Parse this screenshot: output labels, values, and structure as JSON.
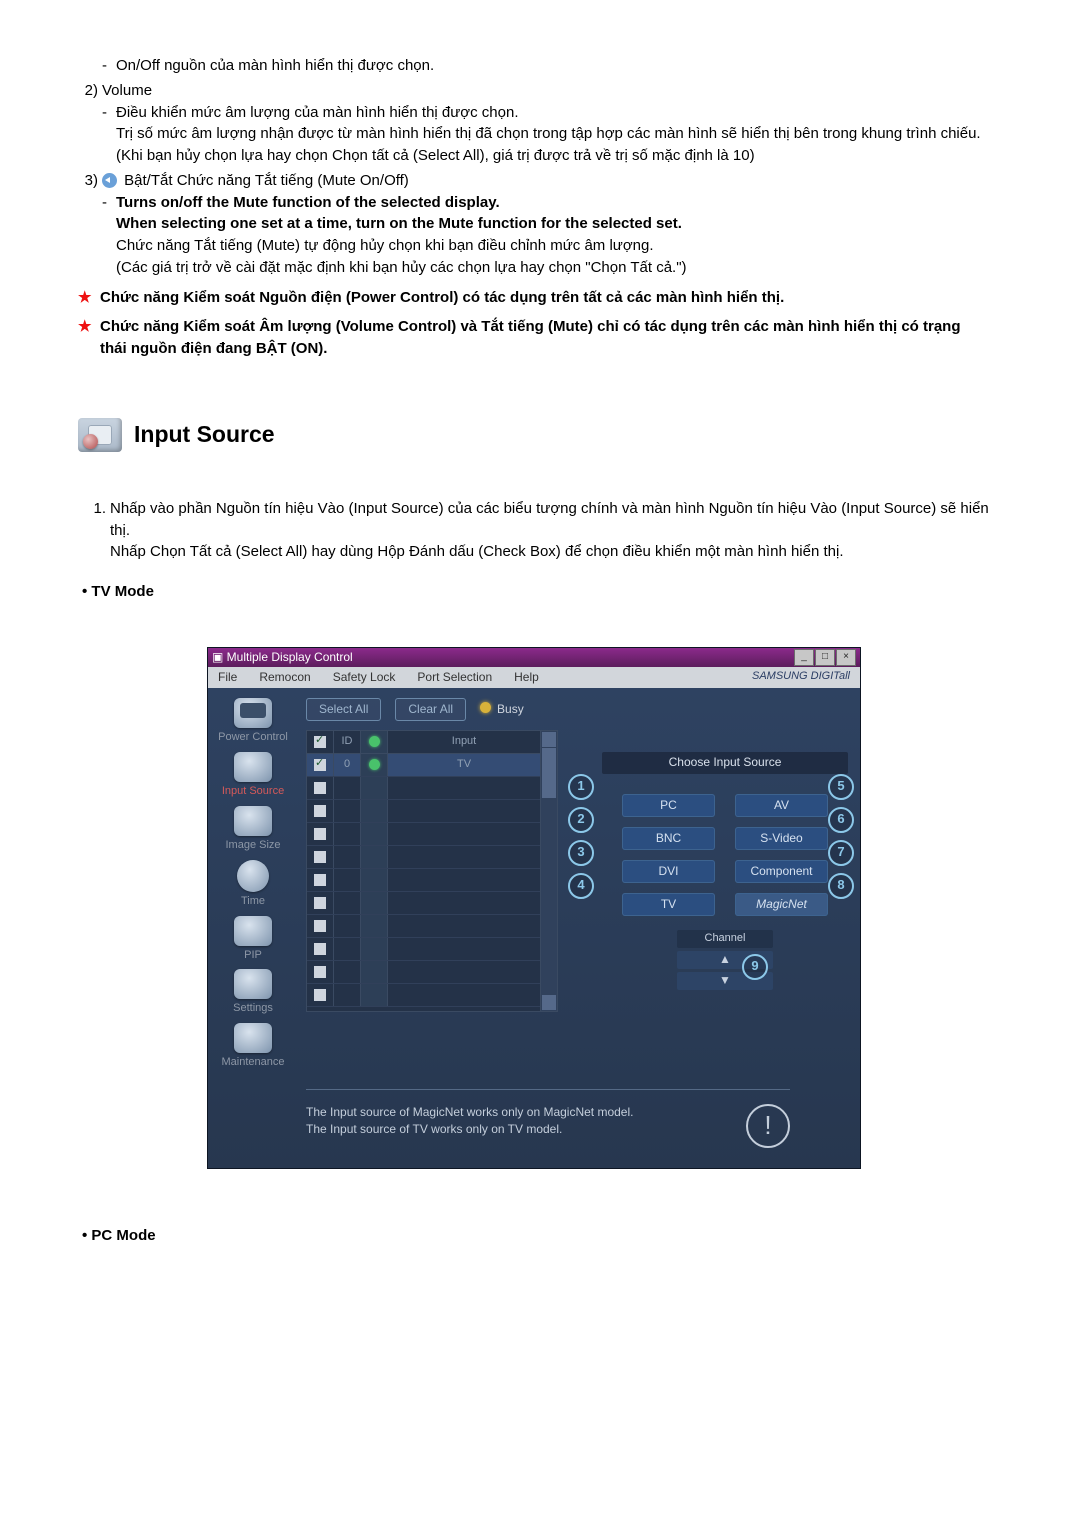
{
  "top": {
    "item_onoff": "On/Off nguồn của màn hình hiển thị được chọn.",
    "item2_num": "2)",
    "item2_title": "Volume",
    "item2_dash": "Điều khiển mức âm lượng của màn hình hiển thị được chọn.",
    "item2_sub1": "Trị số mức âm lượng nhận được từ màn hình hiển thị đã chọn trong tập hợp các màn hình sẽ hiển thị bên trong khung trình chiếu.",
    "item2_sub2": "(Khi bạn hủy chọn lựa hay chọn Chọn tất cả (Select All), giá trị được trả về trị số mặc định là 10)",
    "item3_num": "3)",
    "item3_title": "Bật/Tắt Chức năng Tắt tiếng (Mute On/Off)",
    "item3_dash1": "Turns on/off the Mute function of the selected display.",
    "item3_dash2": "When selecting one set at a time, turn on the Mute function for the selected set.",
    "item3_sub1": "Chức năng Tắt tiếng (Mute) tự động hủy chọn khi bạn điều chỉnh mức âm lượng.",
    "item3_sub2": "(Các giá trị trở về cài đặt mặc định khi bạn hủy các chọn lựa hay chọn \"Chọn Tất cả.\")",
    "star1": "Chức năng Kiểm soát Nguồn điện (Power Control) có tác dụng trên tất cả các màn hình hiển thị.",
    "star2": "Chức năng Kiểm soát Âm lượng (Volume Control) và Tắt tiếng (Mute) chỉ có tác dụng trên các màn hình hiển thị có trạng thái nguồn điện đang BẬT (ON)."
  },
  "section": {
    "title": "Input Source",
    "li1_num": "1.",
    "li1_a": "Nhấp vào phần Nguồn tín hiệu Vào (Input Source) của các biểu tượng chính và màn hình Nguồn tín hiệu Vào (Input Source) sẽ hiển thị.",
    "li1_b": "Nhấp Chọn Tất cả (Select All) hay dùng Hộp Đánh dấu (Check Box) để chọn điều khiển một màn hình hiển thị.",
    "tv_mode": "• TV Mode",
    "pc_mode": "• PC Mode"
  },
  "shot": {
    "title": "Multiple Display Control",
    "menu": {
      "file": "File",
      "rescan": "Remocon",
      "safety": "Safety Lock",
      "port": "Port Selection",
      "help": "Help",
      "brand": "SAMSUNG DIGITall"
    },
    "selectall": "Select All",
    "clearall": "Clear All",
    "busy": "Busy",
    "grid": {
      "chk": "✓",
      "id": "ID",
      "st": "",
      "input": "Input",
      "row_id": "0",
      "row_input": "TV"
    },
    "sidebar": {
      "pc": "Power Control",
      "is": "Input Source",
      "img": "Image Size",
      "time": "Time",
      "pip": "PIP",
      "set": "Settings",
      "maint": "Maintenance"
    },
    "panel": {
      "hdr": "Choose Input Source",
      "pc": "PC",
      "bnc": "BNC",
      "dvi": "DVI",
      "tv": "TV",
      "av": "AV",
      "sv": "S-Video",
      "comp": "Component",
      "magic": "MagicNet",
      "channel": "Channel",
      "up": "▲",
      "down": "▼"
    },
    "circles": {
      "c1": "1",
      "c2": "2",
      "c3": "3",
      "c4": "4",
      "c5": "5",
      "c6": "6",
      "c7": "7",
      "c8": "8",
      "c9": "9"
    },
    "note1": "The Input source of MagicNet works only on MagicNet model.",
    "note2": "The Input source of TV works only on TV model.",
    "excl": "!"
  }
}
